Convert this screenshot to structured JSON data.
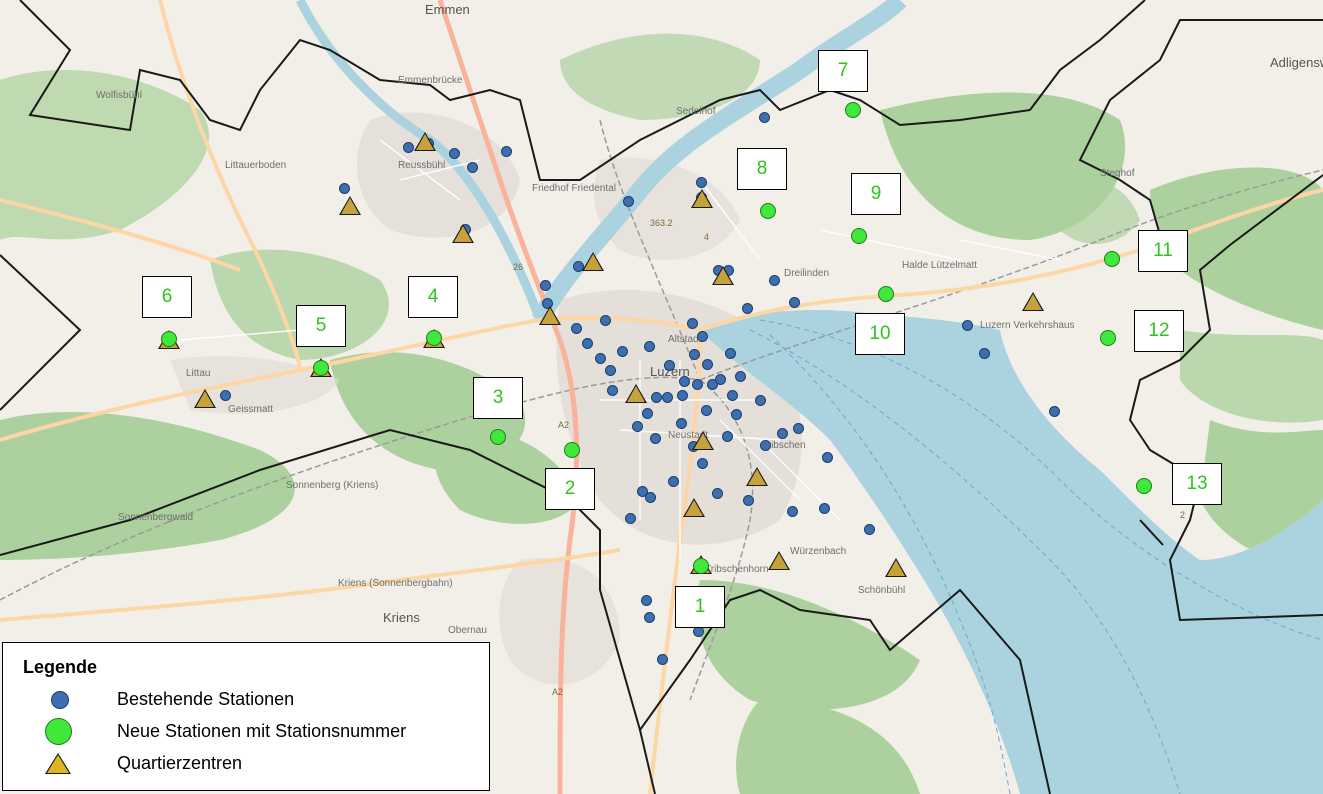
{
  "map": {
    "colors": {
      "land": "#f2efe9",
      "forest": "#add19e",
      "lake": "#aad3df",
      "boundary": "#000000",
      "existing_station": "#3d6fb0",
      "new_station": "#3fe83a",
      "quarter_center": "#c6a23c",
      "station_number_text": "#2ec41f"
    },
    "place_labels": [
      "Emmen",
      "Emmenbrücke",
      "Reussbühl",
      "Littauerboden",
      "Littau",
      "Wolfisbühl",
      "Sedelhof",
      "Friedhof Friedental",
      "Luzern",
      "Altstadt",
      "Neustadt",
      "Tribschen",
      "Halde Lützelmatt",
      "Adligenswil",
      "Sonnenberg (Kriens)",
      "Kriens",
      "Kriens (Sonnenbergbahn)",
      "Obernau",
      "Würzenbach",
      "Schönbühl",
      "Luzern Verkehrshaus",
      "Geissmatt",
      "Sonnenbergwald",
      "Dreilinden",
      "Steghof",
      "Tribschenhorn"
    ],
    "route_labels": [
      "A2",
      "2",
      "4",
      "26",
      "363.2"
    ],
    "existing_stations": 73,
    "new_station_numbers": [
      "1",
      "2",
      "3",
      "4",
      "5",
      "6",
      "7",
      "8",
      "9",
      "10",
      "11",
      "12",
      "13"
    ],
    "quarter_centers": 19
  },
  "legend": {
    "title": "Legende",
    "items": [
      {
        "label": "Bestehende Stationen",
        "symbol": "blue-circle-icon"
      },
      {
        "label": "Neue Stationen mit Stationsnummer",
        "symbol": "green-circle-icon"
      },
      {
        "label": "Quartierzentren",
        "symbol": "orange-triangle-icon"
      }
    ]
  }
}
